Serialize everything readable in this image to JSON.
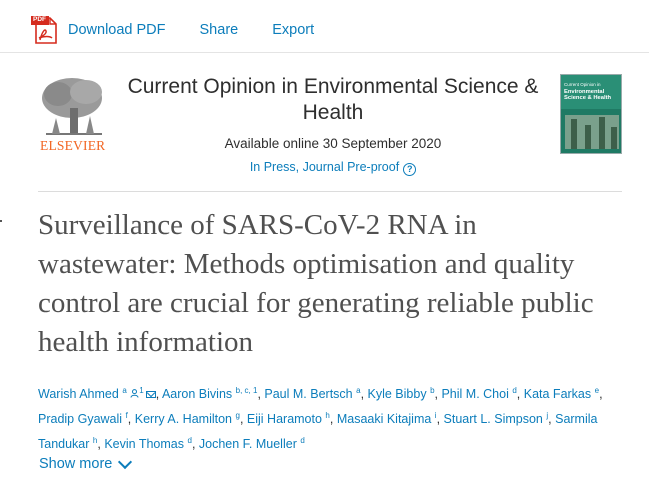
{
  "toolbar": {
    "pdf_badge": "PDF",
    "download_pdf": "Download PDF",
    "share": "Share",
    "export": "Export"
  },
  "journal": {
    "publisher": "ELSEVIER",
    "title": "Current Opinion in Environmental Science & Health",
    "available": "Available online 30 September 2020",
    "status": "In Press, Journal Pre-proof",
    "help_glyph": "?",
    "cover": {
      "line1": "Current Opinion in",
      "line2": "Environmental Science & Health"
    }
  },
  "article": {
    "title": "Surveillance of SARS-CoV-2 RNA in wastewater: Methods optimisation and quality control are crucial for generating reliable public health information"
  },
  "authors": [
    {
      "name": "Warish Ahmed",
      "sup": "a",
      "extra_sup": "1"
    },
    {
      "name": "Aaron Bivins",
      "sup": "b, c, 1"
    },
    {
      "name": "Paul M. Bertsch",
      "sup": "a"
    },
    {
      "name": "Kyle Bibby",
      "sup": "b"
    },
    {
      "name": "Phil M. Choi",
      "sup": "d"
    },
    {
      "name": "Kata Farkas",
      "sup": "e"
    },
    {
      "name": "Pradip Gyawali",
      "sup": "f"
    },
    {
      "name": "Kerry A. Hamilton",
      "sup": "g"
    },
    {
      "name": "Eiji Haramoto",
      "sup": "h"
    },
    {
      "name": "Masaaki Kitajima",
      "sup": "i"
    },
    {
      "name": "Stuart L. Simpson",
      "sup": "j"
    },
    {
      "name": "Sarmila Tandukar",
      "sup": "h"
    },
    {
      "name": "Kevin Thomas",
      "sup": "d"
    },
    {
      "name": "Jochen F. Mueller",
      "sup": "d"
    }
  ],
  "show_more": "Show more",
  "colors": {
    "link": "#0c7dbb",
    "publisher": "#f26522",
    "title_text": "#505050"
  },
  "icons": [
    "pdf-icon",
    "help-icon",
    "person-icon",
    "mail-icon",
    "chevron-down-icon"
  ]
}
